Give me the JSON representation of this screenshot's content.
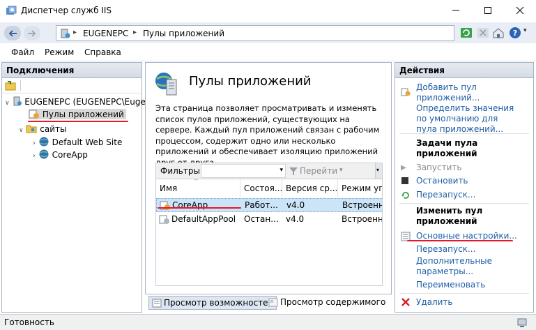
{
  "window": {
    "title": "Диспетчер служб IIS",
    "controls": [
      "minimize",
      "maximize",
      "close"
    ]
  },
  "address": {
    "crumbs": [
      "EUGENEPC",
      "Пулы приложений"
    ]
  },
  "menu": {
    "file": "Файл",
    "view": "Режим",
    "help": "Справка"
  },
  "connections": {
    "header": "Подключения",
    "tree": {
      "server": "EUGENEPC (EUGENEPC\\Euge",
      "app_pools": "Пулы приложений",
      "sites": "сайты",
      "site1": "Default Web Site",
      "site2": "CoreApp"
    }
  },
  "main": {
    "title": "Пулы приложений",
    "description": "Эта страница позволяет просматривать и изменять список пулов приложений, существующих на сервере. Каждый пул приложений связан с рабочим процессом, содержит одно или несколько приложений и обеспечивает изоляцию приложений друг от друга.",
    "filter_label": "Фильтры:",
    "go_label": "Перейти",
    "columns": [
      "Имя",
      "Состоя...",
      "Версия ср...",
      "Режим упр"
    ],
    "rows": [
      {
        "name": "CoreApp",
        "state": "Работ...",
        "version": "v4.0",
        "mode": "Встроенны"
      },
      {
        "name": "DefaultAppPool",
        "state": "Остан...",
        "version": "v4.0",
        "mode": "Встроенны"
      }
    ],
    "tabs": {
      "features": "Просмотр возможностей",
      "content": "Просмотр содержимого"
    }
  },
  "actions": {
    "header": "Действия",
    "add_pool": "Добавить пул приложений...",
    "set_defaults": "Определить значения по умолчанию для пула приложений...",
    "tasks_head": "Задачи пула приложений",
    "start": "Запустить",
    "stop": "Остановить",
    "restart": "Перезапуск...",
    "edit_head": "Изменить пул приложений",
    "basic_settings": "Основные настройки...",
    "recycle": "Перезапуск...",
    "advanced": "Дополнительные параметры...",
    "rename": "Переименовать",
    "delete": "Удалить"
  },
  "status": {
    "text": "Готовность"
  },
  "colors": {
    "accent_link": "#1f5ea8",
    "selection": "#cce4f7",
    "annotation_red": "#e8162a"
  }
}
